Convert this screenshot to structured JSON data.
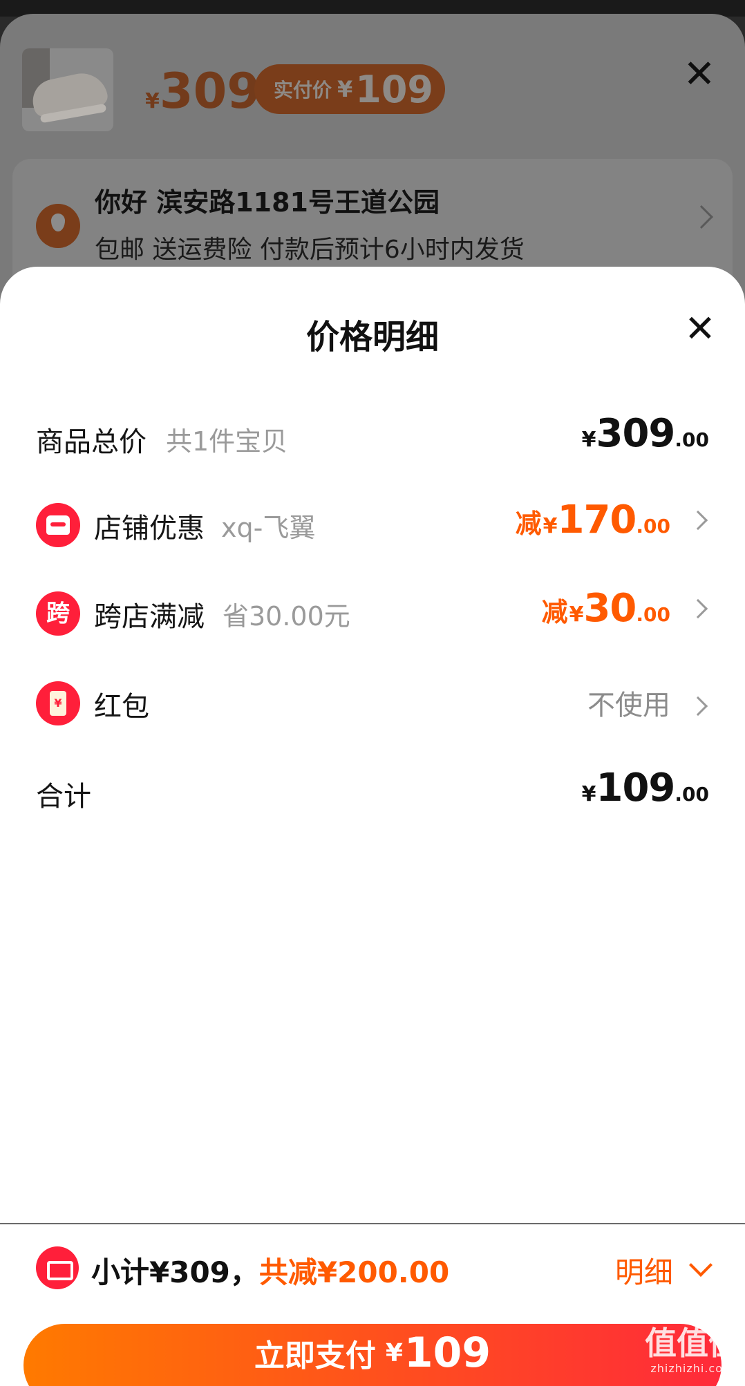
{
  "background": {
    "product_price_yen": "¥",
    "product_price": "309",
    "paid_price_label": "实付价",
    "paid_price_yen": "¥",
    "paid_price": "109",
    "address_line1": "你好 滨安路1181号王道公园",
    "address_line2": "包邮 送运费险 付款后预计6小时内发货",
    "close_icon": "close-icon"
  },
  "sheet": {
    "title": "价格明细",
    "close_glyph": "✕",
    "rows": [
      {
        "label": "商品总价",
        "sub": "共1件宝贝",
        "yen": "¥",
        "amount": "309",
        "decimal": ".00"
      },
      {
        "label": "店铺优惠",
        "sub": "xq-飞翼",
        "prefix": "减",
        "yen": "¥",
        "amount": "170",
        "decimal": ".00",
        "icon": "shop-icon"
      },
      {
        "label": "跨店满减",
        "sub": "省30.00元",
        "prefix": "减",
        "yen": "¥",
        "amount": "30",
        "decimal": ".00",
        "icon": "cross-store-icon",
        "icon_char": "跨"
      },
      {
        "label": "红包",
        "value": "不使用",
        "icon": "red-packet-icon",
        "icon_char": "¥"
      },
      {
        "label": "合计",
        "yen": "¥",
        "amount": "109",
        "decimal": ".00"
      }
    ]
  },
  "bottom": {
    "subtotal_text": "小计¥309，",
    "discount_text": "共减¥200.00",
    "detail_label": "明细",
    "pay_label": "立即支付",
    "pay_yen": "¥",
    "pay_amount": "109"
  },
  "watermark": {
    "glyphs": "值值值",
    "site": "zhizhizhi.com"
  },
  "colors": {
    "accent_orange": "#ff5a00",
    "accent_red": "#ff1f3a",
    "overlay_grey": "#7a7a7a"
  }
}
